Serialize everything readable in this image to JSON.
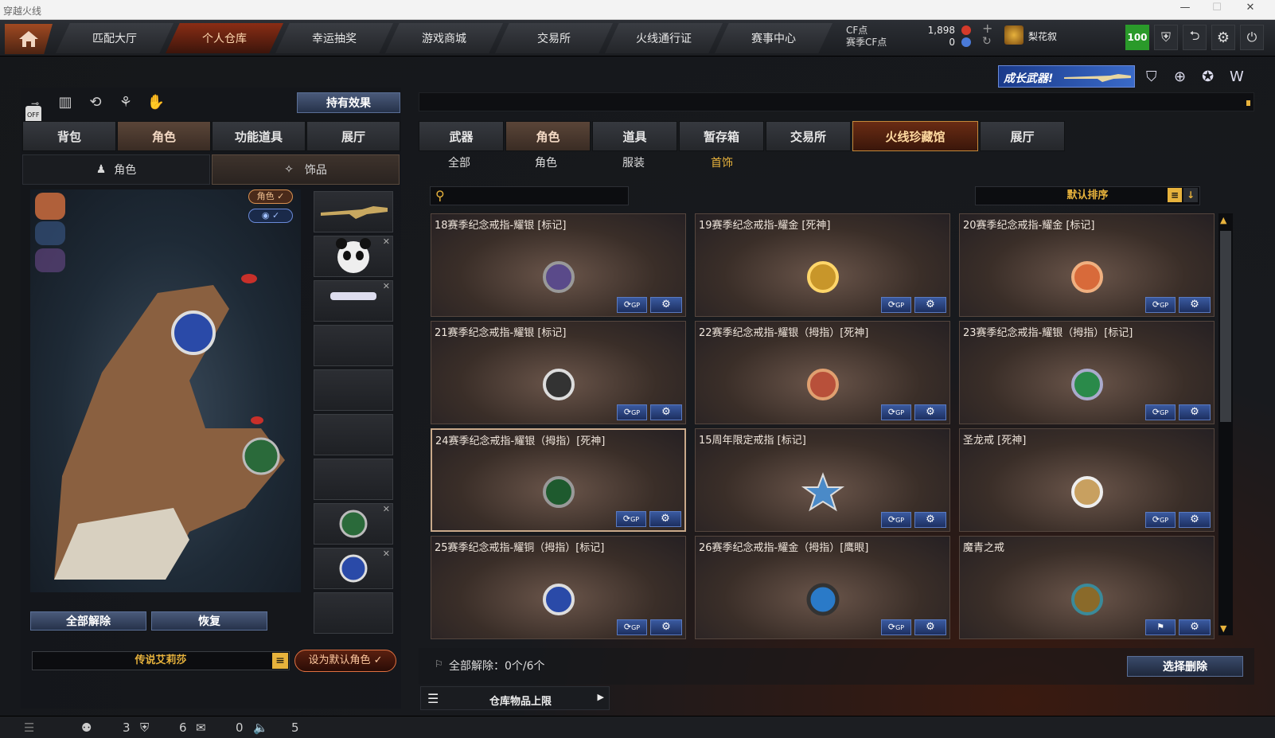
{
  "window": {
    "title": "穿越火线"
  },
  "nav": {
    "tabs": [
      "匹配大厅",
      "个人仓库",
      "幸运抽奖",
      "游戏商城",
      "交易所",
      "火线通行证",
      "赛事中心"
    ],
    "active": 1
  },
  "currency": {
    "cf_label": "CF点",
    "season_label": "赛季CF点",
    "cf_value": "1,898",
    "season_value": "0"
  },
  "user": {
    "name": "梨花叙",
    "level": "100"
  },
  "banner": {
    "text": "成长武器!"
  },
  "left": {
    "hold_effect": "持有效果",
    "tabs": [
      "背包",
      "角色",
      "功能道具",
      "展厅"
    ],
    "active_tab": 1,
    "subtabs": [
      "角色",
      "饰品"
    ],
    "role_badge": "角色 ✓",
    "off_label": "OFF",
    "btn_unequip": "全部解除",
    "btn_restore": "恢复",
    "character_name": "传说艾莉莎",
    "set_default": "设为默认角色 ✓"
  },
  "right": {
    "tabs": [
      "武器",
      "角色",
      "道具",
      "暂存箱",
      "交易所",
      "火线珍藏馆",
      "展厅"
    ],
    "active_tab": 1,
    "gold_tab": 5,
    "subtabs": [
      "全部",
      "角色",
      "服装",
      "首饰"
    ],
    "active_subtab": 3,
    "sort_label": "默认排序",
    "items": [
      "18赛季纪念戒指-耀银 [标记]",
      "19赛季纪念戒指-耀金 [死神]",
      "20赛季纪念戒指-耀金 [标记]",
      "21赛季纪念戒指-耀银  [标记]",
      "22赛季纪念戒指-耀银（拇指）[死神]",
      "23赛季纪念戒指-耀银（拇指）[标记]",
      "24赛季纪念戒指-耀银（拇指）[死神]",
      "15周年限定戒指 [标记]",
      "圣龙戒 [死神]",
      "25赛季纪念戒指-耀铜（拇指）[标记]",
      "26赛季纪念戒指-耀金（拇指）[鹰眼]",
      "魔青之戒"
    ],
    "unequip_status": "全部解除：0个/6个",
    "select_delete": "选择删除",
    "storage_limit": "仓库物品上限",
    "gp_label": "GP"
  },
  "status": {
    "friends": "3",
    "guild": "6",
    "messages": "0",
    "volume": "5"
  },
  "colors": {
    "accent_gold": "#e7b23c",
    "nav_active": "#8a2d15",
    "level_green": "#2a9a2a"
  }
}
